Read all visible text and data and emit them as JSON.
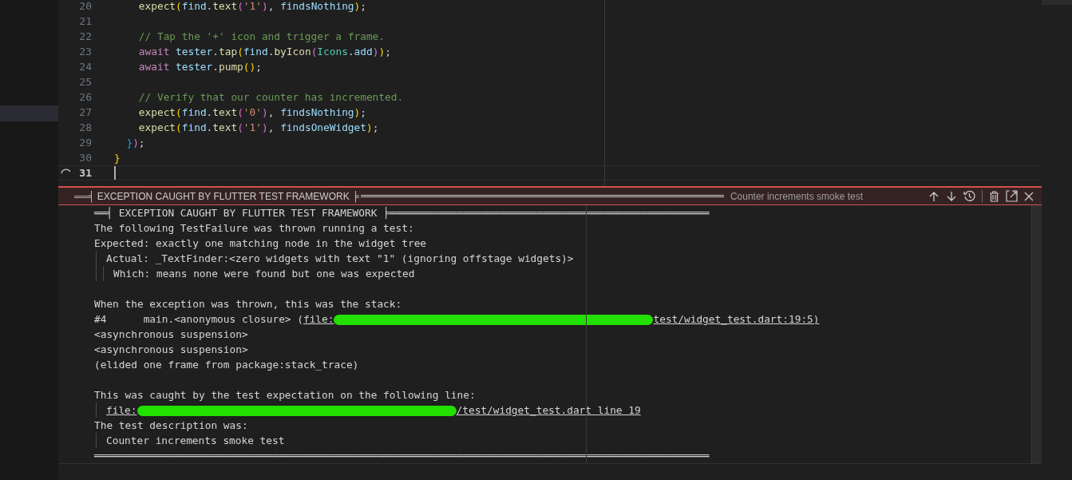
{
  "editor": {
    "lines": [
      {
        "number": "20",
        "current": false,
        "tokens": [
          {
            "t": "    expect",
            "kind": "func"
          },
          {
            "t": "(",
            "kind": "b1"
          },
          {
            "t": "find",
            "kind": "var"
          },
          {
            "t": ".",
            "kind": "plain"
          },
          {
            "t": "text",
            "kind": "func"
          },
          {
            "t": "(",
            "kind": "b2"
          },
          {
            "t": "'1'",
            "kind": "str"
          },
          {
            "t": ")",
            "kind": "b2"
          },
          {
            "t": ",",
            "kind": "plain"
          },
          {
            "t": " findsNothing",
            "kind": "var"
          },
          {
            "t": ")",
            "kind": "b1"
          },
          {
            "t": ";",
            "kind": "plain"
          }
        ]
      },
      {
        "number": "21",
        "current": false
      },
      {
        "number": "22",
        "current": false,
        "tokens": [
          {
            "t": "    // Tap the '+' icon and trigger a frame.",
            "kind": "comment"
          }
        ]
      },
      {
        "number": "23",
        "current": false,
        "tokens": [
          {
            "t": "    await",
            "kind": "keyword"
          },
          {
            "t": " tester",
            "kind": "var"
          },
          {
            "t": ".",
            "kind": "plain"
          },
          {
            "t": "tap",
            "kind": "func"
          },
          {
            "t": "(",
            "kind": "b1"
          },
          {
            "t": "find",
            "kind": "var"
          },
          {
            "t": ".",
            "kind": "plain"
          },
          {
            "t": "byIcon",
            "kind": "func"
          },
          {
            "t": "(",
            "kind": "b2"
          },
          {
            "t": "Icons",
            "kind": "type"
          },
          {
            "t": ".",
            "kind": "plain"
          },
          {
            "t": "add",
            "kind": "var"
          },
          {
            "t": ")",
            "kind": "b2"
          },
          {
            "t": ")",
            "kind": "b1"
          },
          {
            "t": ";",
            "kind": "plain"
          }
        ]
      },
      {
        "number": "24",
        "current": false,
        "tokens": [
          {
            "t": "    await",
            "kind": "keyword"
          },
          {
            "t": " tester",
            "kind": "var"
          },
          {
            "t": ".",
            "kind": "plain"
          },
          {
            "t": "pump",
            "kind": "func"
          },
          {
            "t": "()",
            "kind": "b1"
          },
          {
            "t": ";",
            "kind": "plain"
          }
        ]
      },
      {
        "number": "25",
        "current": false
      },
      {
        "number": "26",
        "current": false,
        "tokens": [
          {
            "t": "    // Verify that our counter has incremented.",
            "kind": "comment"
          }
        ]
      },
      {
        "number": "27",
        "current": false,
        "tokens": [
          {
            "t": "    expect",
            "kind": "func"
          },
          {
            "t": "(",
            "kind": "b1"
          },
          {
            "t": "find",
            "kind": "var"
          },
          {
            "t": ".",
            "kind": "plain"
          },
          {
            "t": "text",
            "kind": "func"
          },
          {
            "t": "(",
            "kind": "b2"
          },
          {
            "t": "'0'",
            "kind": "str"
          },
          {
            "t": ")",
            "kind": "b2"
          },
          {
            "t": ",",
            "kind": "plain"
          },
          {
            "t": " findsNothing",
            "kind": "var"
          },
          {
            "t": ")",
            "kind": "b1"
          },
          {
            "t": ";",
            "kind": "plain"
          }
        ]
      },
      {
        "number": "28",
        "current": false,
        "tokens": [
          {
            "t": "    expect",
            "kind": "func"
          },
          {
            "t": "(",
            "kind": "b1"
          },
          {
            "t": "find",
            "kind": "var"
          },
          {
            "t": ".",
            "kind": "plain"
          },
          {
            "t": "text",
            "kind": "func"
          },
          {
            "t": "(",
            "kind": "b2"
          },
          {
            "t": "'1'",
            "kind": "str"
          },
          {
            "t": ")",
            "kind": "b2"
          },
          {
            "t": ",",
            "kind": "plain"
          },
          {
            "t": " findsOneWidget",
            "kind": "var"
          },
          {
            "t": ")",
            "kind": "b1"
          },
          {
            "t": ";",
            "kind": "plain"
          }
        ]
      },
      {
        "number": "29",
        "current": false,
        "tokens": [
          {
            "t": "  }",
            "kind": "b3"
          },
          {
            "t": ")",
            "kind": "b2"
          },
          {
            "t": ";",
            "kind": "plain"
          }
        ]
      },
      {
        "number": "30",
        "current": false,
        "tokens": [
          {
            "t": "}",
            "kind": "b1"
          }
        ]
      },
      {
        "number": "31",
        "current": true
      }
    ]
  },
  "peek": {
    "title": "══╡ EXCEPTION CAUGHT BY FLUTTER TEST FRAMEWORK ╞",
    "subtitle": "Counter increments smoke test",
    "blocks": [
      [
        {
          "parts": [
            {
              "kind": "text",
              "text": "══╡ EXCEPTION CAUGHT BY FLUTTER TEST FRAMEWORK ╞════════════════════════════════════════════════════"
            }
          ]
        },
        {
          "parts": [
            {
              "kind": "text",
              "text": "The following TestFailure was thrown running a test:"
            }
          ]
        },
        {
          "parts": [
            {
              "kind": "text",
              "text": "Expected: exactly one matching node in the widget tree"
            }
          ],
          "children": [
            {
              "parts": [
                {
                  "kind": "text",
                  "text": "Actual: _TextFinder:<zero widgets with text \"1\" (ignoring offstage widgets)>"
                }
              ],
              "children": [
                {
                  "parts": [
                    {
                      "kind": "text",
                      "text": "Which: means none were found but one was expected"
                    }
                  ]
                }
              ]
            }
          ]
        }
      ],
      [
        {
          "parts": [
            {
              "kind": "text",
              "text": "When the exception was thrown, this was the stack:"
            }
          ]
        },
        {
          "parts": [
            {
              "kind": "text",
              "text": "#4      main.<anonymous closure> ("
            },
            {
              "kind": "link",
              "segments": [
                {
                  "kind": "text",
                  "text": "file:"
                },
                {
                  "kind": "redaction"
                },
                {
                  "kind": "text",
                  "text": "test/widget_test.dart:19:5)"
                }
              ]
            }
          ]
        },
        {
          "parts": [
            {
              "kind": "text",
              "text": "<asynchronous suspension>"
            }
          ]
        },
        {
          "parts": [
            {
              "kind": "text",
              "text": "<asynchronous suspension>"
            }
          ]
        },
        {
          "parts": [
            {
              "kind": "text",
              "text": "(elided one frame from package:stack_trace)"
            }
          ]
        }
      ],
      [
        {
          "parts": [
            {
              "kind": "text",
              "text": "This was caught by the test expectation on the following line:"
            }
          ],
          "children": [
            {
              "parts": [
                {
                  "kind": "link",
                  "segments": [
                    {
                      "kind": "text",
                      "text": "file:"
                    },
                    {
                      "kind": "redaction"
                    },
                    {
                      "kind": "text",
                      "text": "/test/widget_test.dart line 19"
                    }
                  ]
                }
              ]
            }
          ]
        },
        {
          "parts": [
            {
              "kind": "text",
              "text": "The test description was:"
            }
          ],
          "children": [
            {
              "parts": [
                {
                  "kind": "text",
                  "text": "Counter increments smoke test"
                }
              ]
            }
          ]
        },
        {
          "parts": [
            {
              "kind": "text",
              "text": "════════════════════════════════════════════════════════════════════════════════════════════════════"
            }
          ]
        }
      ]
    ]
  }
}
